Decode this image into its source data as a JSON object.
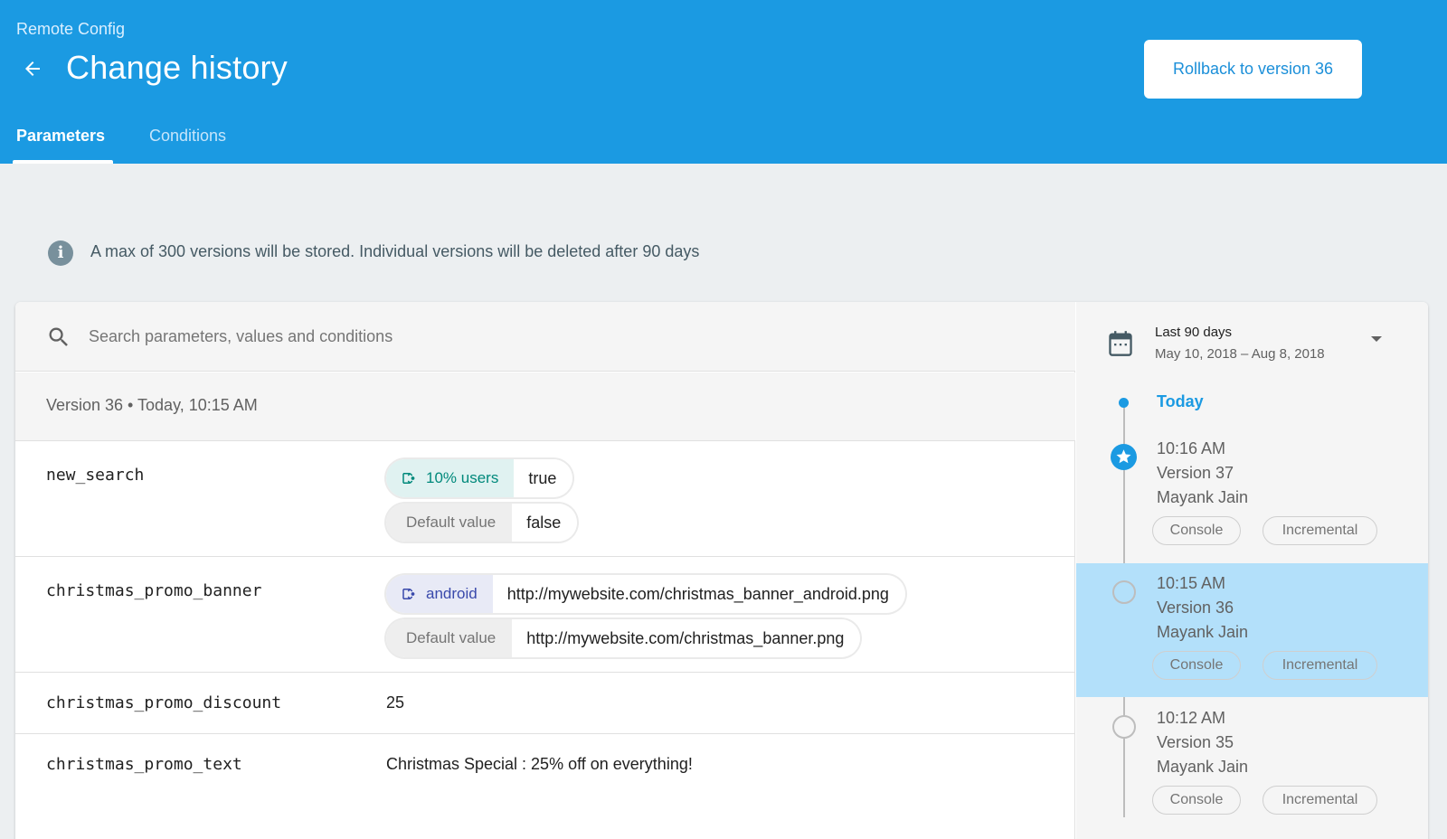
{
  "header": {
    "breadcrumb": "Remote Config",
    "title": "Change history",
    "rollback_label": "Rollback to version 36",
    "tabs": [
      {
        "label": "Parameters",
        "active": true
      },
      {
        "label": "Conditions",
        "active": false
      }
    ]
  },
  "info": {
    "text": "A max of 300 versions will be stored. Individual versions will be deleted after 90 days"
  },
  "search": {
    "placeholder": "Search parameters, values and conditions",
    "value": ""
  },
  "version_header": "Version 36 • Today, 10:15 AM",
  "parameters": [
    {
      "name": "new_search",
      "conditions": [
        {
          "label": "10% users",
          "value": "true",
          "style": "green"
        },
        {
          "label": "Default value",
          "value": "false",
          "style": "grey"
        }
      ]
    },
    {
      "name": "christmas_promo_banner",
      "conditions": [
        {
          "label": "android",
          "value": "http://mywebsite.com/christmas_banner_android.png",
          "style": "blue"
        },
        {
          "label": "Default value",
          "value": "http://mywebsite.com/christmas_banner.png",
          "style": "grey"
        }
      ]
    },
    {
      "name": "christmas_promo_discount",
      "value": "25"
    },
    {
      "name": "christmas_promo_text",
      "value": "Christmas Special : 25% off on everything!"
    }
  ],
  "date_range": {
    "title": "Last 90 days",
    "dates": "May 10, 2018 – Aug 8, 2018"
  },
  "timeline": {
    "group_label": "Today",
    "entries": [
      {
        "time": "10:16 AM",
        "version": "Version 37",
        "author": "Mayank Jain",
        "tags": [
          "Console",
          "Incremental"
        ],
        "marker": "star-icon",
        "selected": false
      },
      {
        "time": "10:15 AM",
        "version": "Version 36",
        "author": "Mayank Jain",
        "tags": [
          "Console",
          "Incremental"
        ],
        "marker": "ring",
        "selected": true
      },
      {
        "time": "10:12 AM",
        "version": "Version 35",
        "author": "Mayank Jain",
        "tags": [
          "Console",
          "Incremental"
        ],
        "marker": "ring",
        "selected": false
      }
    ]
  },
  "colors": {
    "header_bg": "#1b9ae2",
    "selected_bg": "#b3e0fa",
    "chip_green": "#00897b",
    "chip_blue": "#3949ab"
  }
}
